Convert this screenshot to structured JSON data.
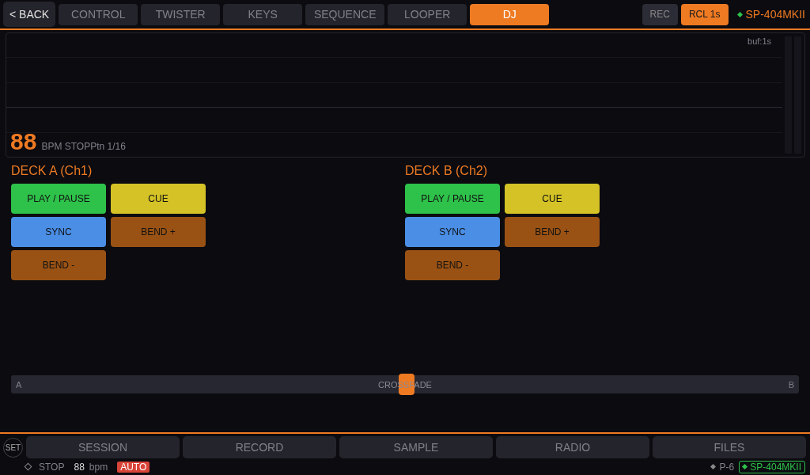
{
  "back": "< BACK",
  "tabs": [
    {
      "label": "CONTROL",
      "selected": false
    },
    {
      "label": "TWISTER",
      "selected": false
    },
    {
      "label": "KEYS",
      "selected": false
    },
    {
      "label": "SEQUENCE",
      "selected": false
    },
    {
      "label": "LOOPER",
      "selected": false
    },
    {
      "label": "DJ",
      "selected": true
    }
  ],
  "rec": {
    "label": "REC",
    "on": false
  },
  "recall": {
    "label": "RCL 1s",
    "on": true
  },
  "device": "SP-404MKII",
  "monitor": {
    "buffer": "buf:1s",
    "bpm": "88",
    "info": "BPM STOPPtn 1/16"
  },
  "decks": [
    {
      "title": "DECK A (Ch1)",
      "pads": [
        {
          "label": "PLAY / PAUSE",
          "color": "#2ec24a"
        },
        {
          "label": "CUE",
          "color": "#d4c226"
        },
        {
          "label": "SYNC",
          "color": "#4a8ee6"
        },
        {
          "label": "BEND +",
          "color": "#9a5214"
        },
        {
          "label": "BEND -",
          "color": "#9a5214"
        }
      ]
    },
    {
      "title": "DECK B (Ch2)",
      "pads": [
        {
          "label": "PLAY / PAUSE",
          "color": "#2ec24a"
        },
        {
          "label": "CUE",
          "color": "#d4c226"
        },
        {
          "label": "SYNC",
          "color": "#4a8ee6"
        },
        {
          "label": "BEND +",
          "color": "#9a5214"
        },
        {
          "label": "BEND -",
          "color": "#9a5214"
        }
      ]
    }
  ],
  "crossfader": {
    "left": "A",
    "label": "CROSSFADE",
    "right": "B",
    "level": 0.5
  },
  "set": "SET",
  "bottom_tabs": [
    {
      "label": "SESSION",
      "selected": false
    },
    {
      "label": "RECORD",
      "selected": false
    },
    {
      "label": "SAMPLE",
      "selected": false
    },
    {
      "label": "RADIO",
      "selected": false
    },
    {
      "label": "FILES",
      "selected": false
    }
  ],
  "status": {
    "transport": "STOP",
    "bpm": "88",
    "bpm_unit": "bpm",
    "mode": "AUTO",
    "preset": "P-6",
    "device": "SP-404MKII"
  }
}
